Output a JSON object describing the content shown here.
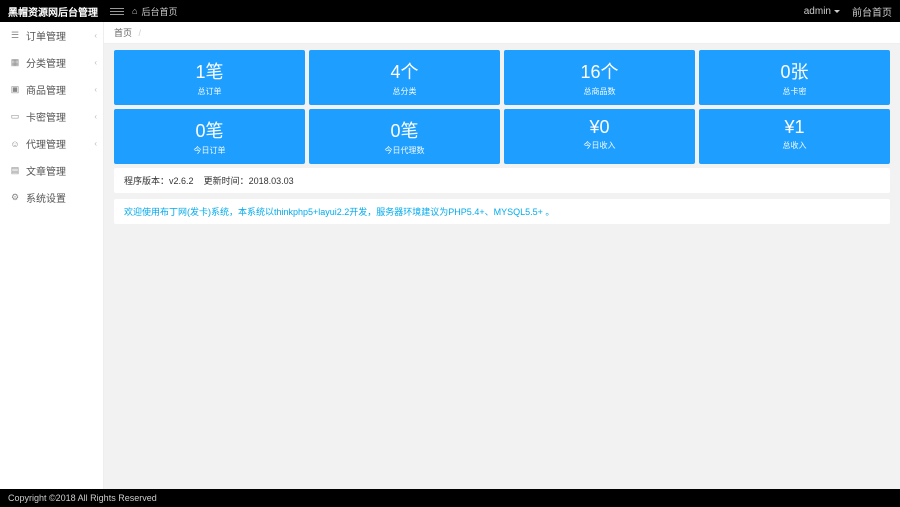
{
  "header": {
    "title": "黑帽资源网后台管理",
    "home_label": "后台首页",
    "admin_label": "admin",
    "front_label": "前台首页"
  },
  "sidebar": {
    "items": [
      {
        "label": "订单管理"
      },
      {
        "label": "分类管理"
      },
      {
        "label": "商品管理"
      },
      {
        "label": "卡密管理"
      },
      {
        "label": "代理管理"
      },
      {
        "label": "文章管理"
      },
      {
        "label": "系统设置"
      }
    ]
  },
  "breadcrumb": {
    "text": "首页"
  },
  "tiles_row1": [
    {
      "value": "1笔",
      "label": "总订单"
    },
    {
      "value": "4个",
      "label": "总分类"
    },
    {
      "value": "16个",
      "label": "总商品数"
    },
    {
      "value": "0张",
      "label": "总卡密"
    }
  ],
  "tiles_row2": [
    {
      "value": "0笔",
      "label": "今日订单"
    },
    {
      "value": "0笔",
      "label": "今日代理数"
    },
    {
      "value": "¥0",
      "label": "今日收入"
    },
    {
      "value": "¥1",
      "label": "总收入"
    }
  ],
  "info": {
    "version_label": "程序版本：",
    "version": "v2.6.2",
    "date_label": "更新时间：",
    "date": "2018.03.03"
  },
  "welcome": "欢迎使用布丁网(发卡)系统，本系统以thinkphp5+layui2.2开发，服务器环境建议为PHP5.4+、MYSQL5.5+ 。",
  "footer": "Copyright ©2018 All Rights Reserved"
}
